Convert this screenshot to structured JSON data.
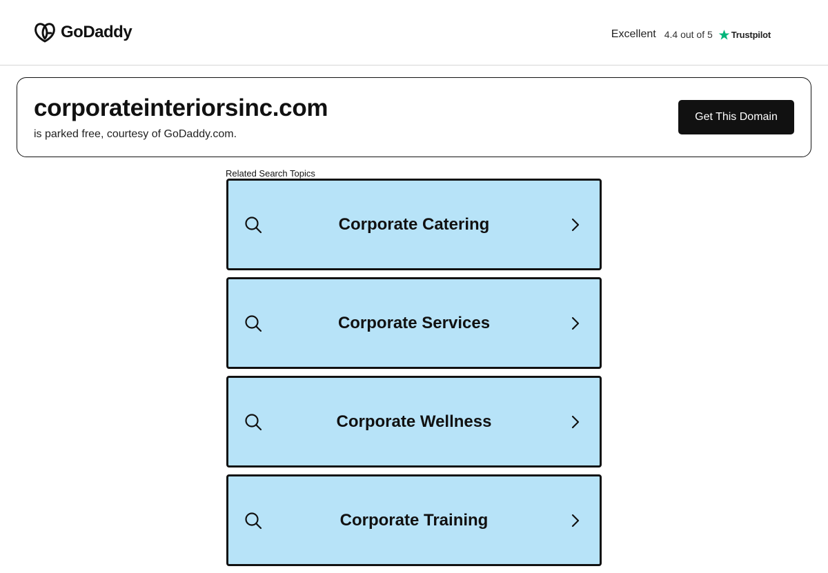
{
  "header": {
    "brand": "GoDaddy",
    "trustpilot": {
      "rating_word": "Excellent",
      "score": "4.4 out of 5",
      "brand": "Trustpilot",
      "star_color": "#00b67a",
      "star_icon": "star-icon"
    }
  },
  "domain_card": {
    "domain": "corporateinteriorsinc.com",
    "subtitle": "is parked free, courtesy of GoDaddy.com.",
    "cta_label": "Get This Domain"
  },
  "related": {
    "label": "Related Search Topics",
    "topics": [
      {
        "label": "Corporate Catering"
      },
      {
        "label": "Corporate Services"
      },
      {
        "label": "Corporate Wellness"
      },
      {
        "label": "Corporate Training"
      }
    ]
  },
  "colors": {
    "topic_bg": "#b7e3f8",
    "cta_bg": "#111111",
    "trust_star": "#00b67a"
  }
}
